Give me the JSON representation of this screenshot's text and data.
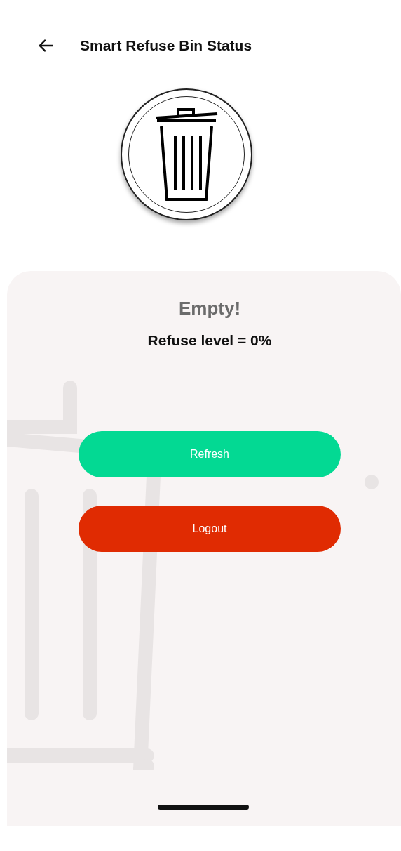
{
  "header": {
    "title": "Smart Refuse Bin Status"
  },
  "status": {
    "headline": "Empty!",
    "reading": "Refuse level = 0%"
  },
  "buttons": [
    {
      "label": "Refresh",
      "kind": "refresh"
    },
    {
      "label": "Logout",
      "kind": "logout"
    }
  ]
}
